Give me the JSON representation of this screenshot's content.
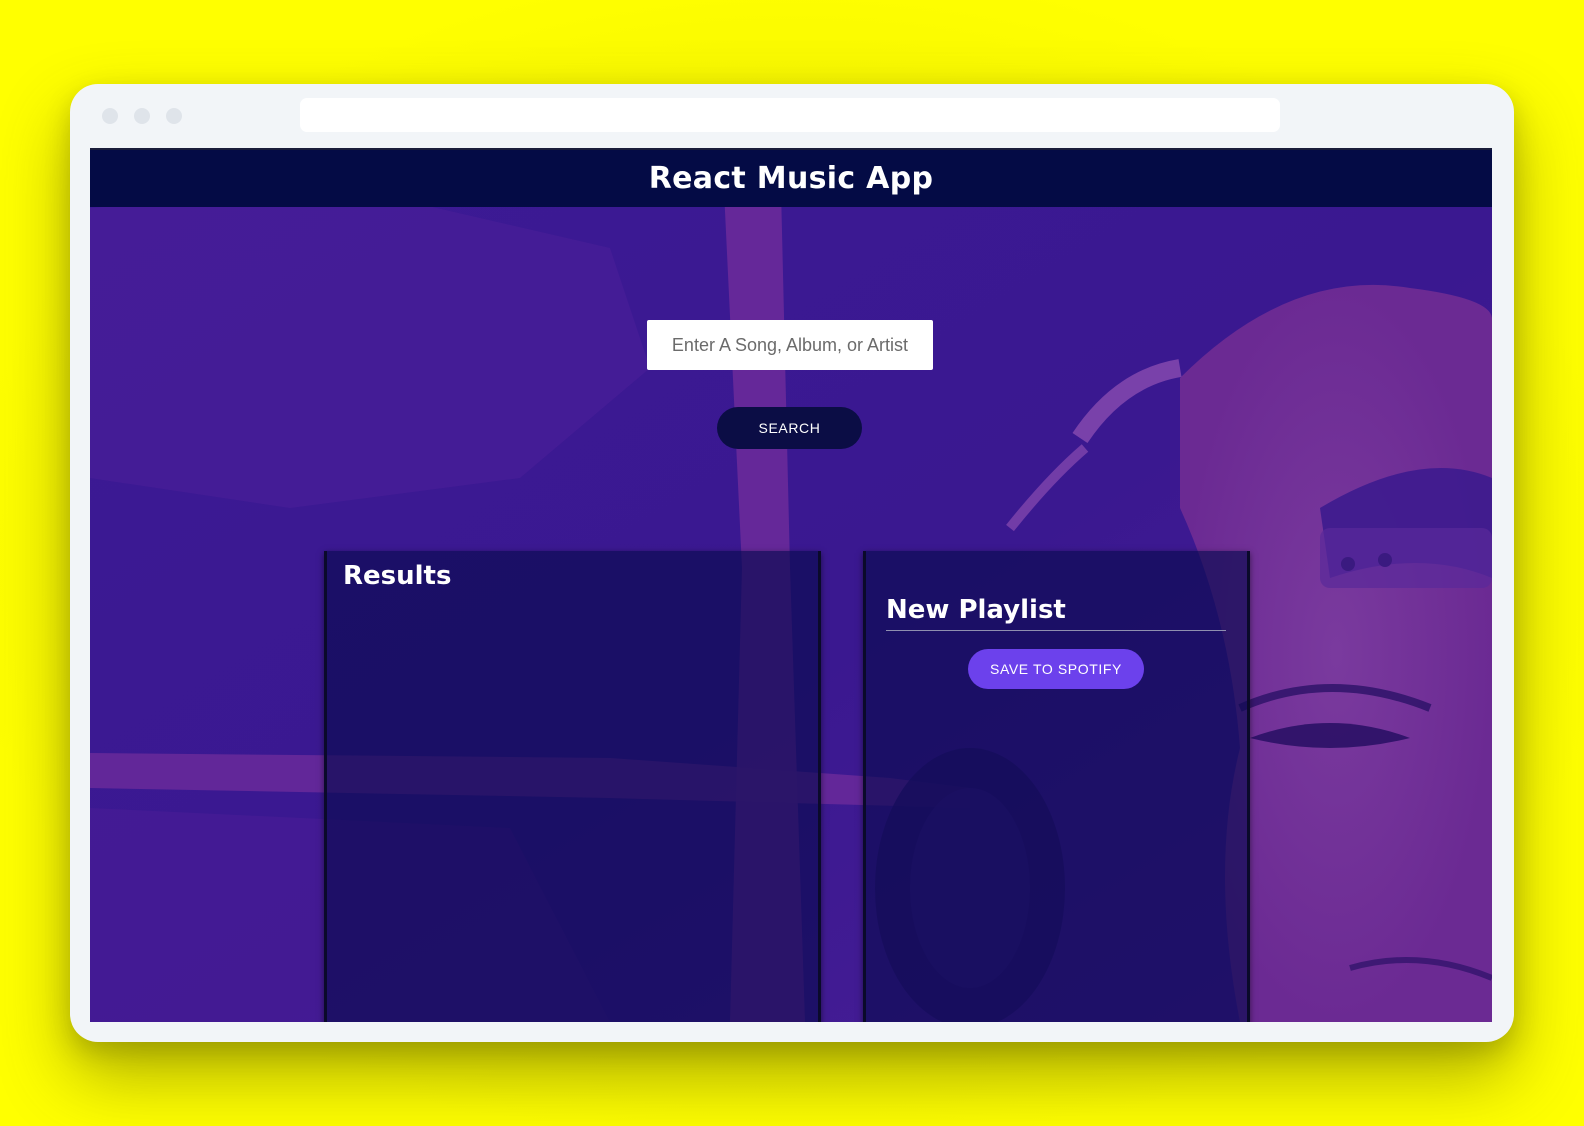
{
  "app": {
    "title": "React Music App"
  },
  "search": {
    "placeholder": "Enter A Song, Album, or Artist",
    "value": "",
    "button_label": "SEARCH"
  },
  "results": {
    "heading": "Results",
    "items": []
  },
  "playlist": {
    "name": "New Playlist",
    "tracks": [],
    "save_label": "SAVE TO SPOTIFY"
  },
  "colors": {
    "page_background": "#ffff00",
    "header": "#040b45",
    "search_button": "#0b0d45",
    "save_button": "#6c41ec",
    "hero_purple": "#3a1890"
  },
  "icons": {
    "window_controls": [
      "close-dot",
      "minimize-dot",
      "maximize-dot"
    ]
  }
}
